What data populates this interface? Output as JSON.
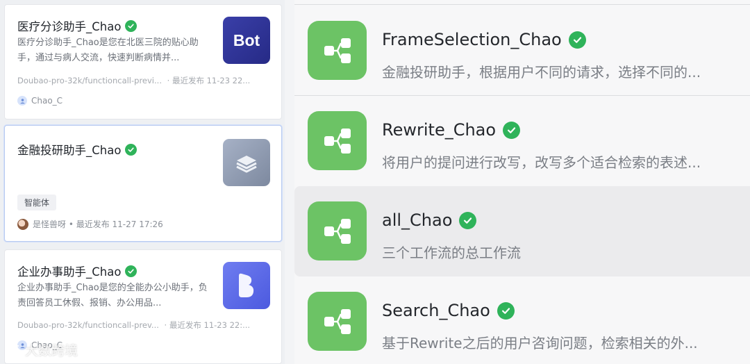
{
  "left_cards": [
    {
      "title": "医疗分诊助手_Chao",
      "description": "医疗分诊助手_Chao是您在北医三院的贴心助手，通过与病人交流，快速判断病情并...",
      "model": "Doubao-pro-32k/functioncall-previ...",
      "published": "· 最近发布 11-23 22...",
      "author": "Chao_C",
      "thumb": "Bot"
    },
    {
      "title": "金融投研助手_Chao",
      "tag": "智能体",
      "author_meta": "是怪兽呀 • 最近发布 11-27 17:26",
      "thumb_icon": "layers-icon"
    },
    {
      "title": "企业办事助手_Chao",
      "description": "企业办事助手_Chao是您的全能办公小助手，负责回答员工休假、报销、办公用品...",
      "model": "Doubao-pro-32k/functioncall-prev...",
      "published": "· 最近发布 11-23 22:...",
      "author": "Chao_C",
      "thumb_icon": "b-logo-icon"
    }
  ],
  "watermark": "大数跨境",
  "workflows": [
    {
      "name": "FrameSelection_Chao",
      "description": "金融投研助手，根据用户不同的请求，选择不同的..."
    },
    {
      "name": "Rewrite_Chao",
      "description": "将用户的提问进行改写，改写多个适合检索的表述..."
    },
    {
      "name": "all_Chao",
      "description": "三个工作流的总工作流",
      "active": true
    },
    {
      "name": "Search_Chao",
      "description": "基于Rewrite之后的用户咨询问题，检索相关的外..."
    }
  ],
  "colors": {
    "verified": "#2fb35a",
    "workflow_icon": "#6cc365",
    "selected_border": "#b9cbf0"
  }
}
